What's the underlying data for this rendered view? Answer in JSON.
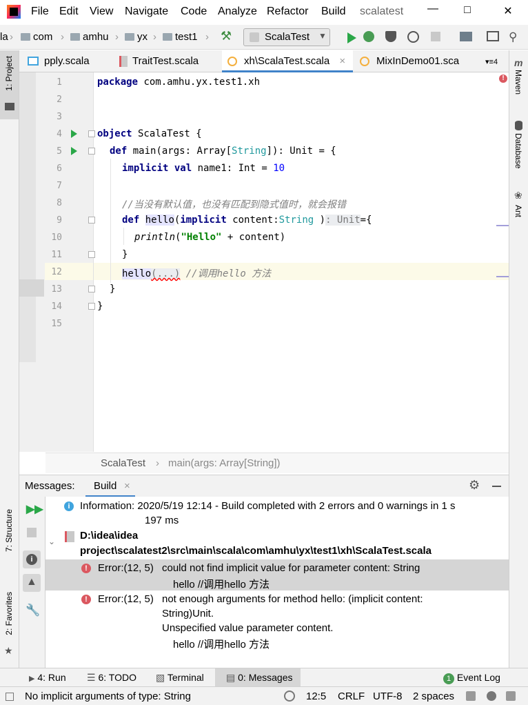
{
  "titlebar": {
    "menus": [
      "File",
      "Edit",
      "View",
      "Navigate",
      "Code",
      "Analyze",
      "Refactor",
      "Build"
    ],
    "project": "scalatest"
  },
  "navbar": {
    "crumbs": [
      "la",
      "com",
      "amhu",
      "yx",
      "test1"
    ],
    "run_config": "ScalaTest"
  },
  "tabs": [
    {
      "label": "pply.scala"
    },
    {
      "label": "TraitTest.scala"
    },
    {
      "label": "xh\\ScalaTest.scala"
    },
    {
      "label": "MixInDemo01.sca"
    },
    {
      "label": "4"
    }
  ],
  "left_tools": {
    "project": "1: Project",
    "structure": "7: Structure",
    "favorites": "2: Favorites"
  },
  "right_tools": {
    "maven": "Maven",
    "database": "Database",
    "ant": "Ant"
  },
  "editor": {
    "line_numbers": [
      "1",
      "2",
      "3",
      "4",
      "5",
      "6",
      "7",
      "8",
      "9",
      "10",
      "11",
      "12",
      "13",
      "14",
      "15"
    ],
    "l1_kw": "package",
    "l1_rest": " com.amhu.yx.test1.xh",
    "l4_kw": "object",
    "l4_rest": " ScalaTest {",
    "l5_kw": "def",
    "l5_a": " main(args: Array[",
    "l5_ty": "String",
    "l5_b": "]): Unit = {",
    "l6_kw1": "implicit",
    "l6_kw2": "val",
    "l6_a": " name1: Int = ",
    "l6_num": "10",
    "l8_cmt": "//当没有默认值，也没有匹配到隐式值时，就会报错",
    "l9_kw": "def",
    "l9_fn": "hello",
    "l9_a": "(",
    "l9_kw2": "implicit",
    "l9_b": " content:",
    "l9_ty": "String",
    "l9_c": " )",
    "l9_hint": ": Unit",
    "l9_d": "={",
    "l10_fn": "println",
    "l10_a": "(",
    "l10_str": "\"Hello\"",
    "l10_b": " + content)",
    "l11": "}",
    "l12_fn": "hello",
    "l12_hint": "(...)",
    "l12_cmt": " //调用hello 方法",
    "l13": "}",
    "l14": "}"
  },
  "breadcrumb": {
    "obj": "ScalaTest",
    "method": "main(args: Array[String])"
  },
  "messages": {
    "title": "Messages:",
    "tab": "Build",
    "info_label": "Information:",
    "info_text": "2020/5/19 12:14 - Build completed with 2 errors and 0 warnings in 1 s",
    "info_text2": "197 ms",
    "path1": "D:\\idea\\idea",
    "path2": "project\\scalatest2\\src\\main\\scala\\com\\amhu\\yx\\test1\\xh\\ScalaTest.scala",
    "err1_loc": "Error:(12, 5)",
    "err1_msg": "could not find implicit value for parameter content: String",
    "err1_code": "hello //调用hello 方法",
    "err2_loc": "Error:(12, 5)",
    "err2_msg1": "not enough arguments for method hello: (implicit content:",
    "err2_msg2": "String)Unit.",
    "err2_msg3": "Unspecified value parameter content.",
    "err2_code": "hello //调用hello 方法"
  },
  "toolwindows": {
    "run": "4: Run",
    "todo": "6: TODO",
    "terminal": "Terminal",
    "messages": "0: Messages",
    "eventlog": "Event Log",
    "eventlog_count": "1"
  },
  "status": {
    "text": "No implicit arguments of type: String",
    "pos": "12:5",
    "sep": "CRLF",
    "enc": "UTF-8",
    "indent": "2 spaces"
  },
  "colors": {
    "keyword": "#000080",
    "string": "#008000",
    "comment": "#808080",
    "type": "#20999d",
    "error": "#db5860",
    "accent": "#4083c9"
  }
}
